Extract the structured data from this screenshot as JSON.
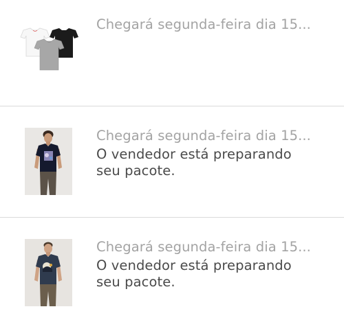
{
  "orders": [
    {
      "title": "Chegará segunda-feira dia 15...",
      "subtitle": "",
      "image": "three-t-shirts-image"
    },
    {
      "title": "Chegará segunda-feira dia 15...",
      "subtitle": "O vendedor está preparando seu pacote.",
      "image": "man-black-tshirt-image"
    },
    {
      "title": "Chegará segunda-feira dia 15...",
      "subtitle": "O vendedor está preparando seu pacote.",
      "image": "man-navy-tshirt-image"
    }
  ],
  "colors": {
    "title": "#a3a3a3",
    "subtitle": "#4a4a4a",
    "divider": "#dadada",
    "background": "#ffffff"
  }
}
